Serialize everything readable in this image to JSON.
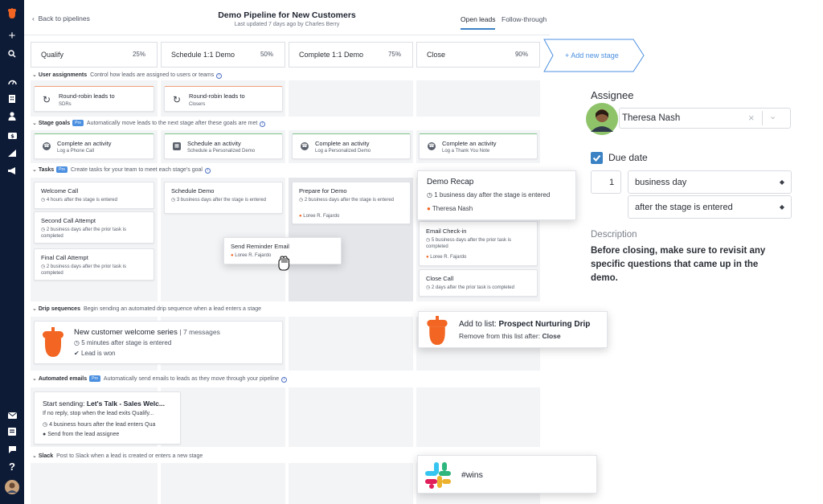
{
  "header": {
    "back_label": "Back to pipelines",
    "title": "Demo Pipeline for New Customers",
    "subtitle": "Last updated 7 days ago by Charles Berry",
    "tabs": [
      "Open leads",
      "Follow-through"
    ]
  },
  "stages": [
    {
      "name": "Qualify",
      "pct": "25%"
    },
    {
      "name": "Schedule 1:1 Demo",
      "pct": "50%"
    },
    {
      "name": "Complete 1:1 Demo",
      "pct": "75%"
    },
    {
      "name": "Close",
      "pct": "90%"
    }
  ],
  "add_stage_label": "+ Add new stage",
  "sections": {
    "user_assignments": {
      "title": "User assignments",
      "desc": "Control how leads are assigned to users or teams"
    },
    "stage_goals": {
      "title": "Stage goals",
      "badge": "Pro",
      "desc": "Automatically move leads to the next stage after these goals are met"
    },
    "tasks": {
      "title": "Tasks",
      "badge": "Pro",
      "desc": "Create tasks for your team to meet each stage's goal"
    },
    "drip": {
      "title": "Drip sequences",
      "desc": "Begin sending an automated drip sequence when a lead enters a stage"
    },
    "emails": {
      "title": "Automated emails",
      "badge": "Pro",
      "desc": "Automatically send emails to leads as they move through your pipeline"
    },
    "slack": {
      "title": "Slack",
      "desc": "Post to Slack when a lead is created or enters a new stage"
    }
  },
  "assignments": [
    {
      "title": "Round-robin leads to",
      "sub": "SDRs"
    },
    {
      "title": "Round-robin leads to",
      "sub": "Closers"
    }
  ],
  "goals": [
    {
      "title": "Complete an activity",
      "sub": "Log a Phone Call"
    },
    {
      "title": "Schedule an activity",
      "sub": "Schedule a Personalized Demo"
    },
    {
      "title": "Complete an activity",
      "sub": "Log a Personalized Demo"
    },
    {
      "title": "Complete an activity",
      "sub": "Log a Thank You Note"
    }
  ],
  "tasks": {
    "welcome": {
      "title": "Welcome Call",
      "sub": "4 hours after the stage is entered"
    },
    "second": {
      "title": "Second Call Attempt",
      "sub": "2 business days after the prior task is completed"
    },
    "final": {
      "title": "Final Call Attempt",
      "sub": "2 business days after the prior task is completed"
    },
    "schedule_demo": {
      "title": "Schedule Demo",
      "sub": "3 business days after the stage is entered"
    },
    "prepare": {
      "title": "Prepare for Demo",
      "sub": "2 business days after the stage is entered",
      "owner": "Loree R. Fajardo"
    },
    "reminder": {
      "title": "Send Reminder Email",
      "owner": "Loree R. Fajardo"
    },
    "demo_recap": {
      "title": "Demo Recap",
      "sub": "1 business day after the stage is entered",
      "owner": "Theresa Nash"
    },
    "checkin": {
      "title": "Email Check-in",
      "sub": "5 business days after the prior task is completed",
      "owner": "Loree R. Fajardo"
    },
    "close_call": {
      "title": "Close Call",
      "sub": "2 days after the prior task is completed"
    }
  },
  "drip_card": {
    "title": "New customer welcome series",
    "count": "| 7 messages",
    "timing": "5 minutes after stage is entered",
    "cond": "Lead is won"
  },
  "drip_pop": {
    "prefix": "Add to list: ",
    "list": "Prospect Nurturing Drip",
    "remove_prefix": "Remove from this list after: ",
    "remove_stage": "Close"
  },
  "email_card": {
    "prefix": "Start sending: ",
    "name": "Let's Talk - Sales Welc...",
    "stop": "If no reply, stop when the lead exits Qualify...",
    "timing": "4 business hours after the lead enters Qua",
    "from": "Send from the lead assignee"
  },
  "slack_pop": {
    "channel": "#wins"
  },
  "panel": {
    "assignee_label": "Assignee",
    "assignee_name": "Theresa Nash",
    "due_label": "Due date",
    "due_num": "1",
    "due_unit": "business day",
    "due_rel": "after the stage is entered",
    "desc_label": "Description",
    "desc_text": "Before closing, make sure to revisit any specific questions that came up in the demo."
  },
  "colors": {
    "sidebar": "#0e1b36",
    "accent": "#3b82c4",
    "brand_orange": "#f26522",
    "checkbox": "#3b82c4"
  }
}
